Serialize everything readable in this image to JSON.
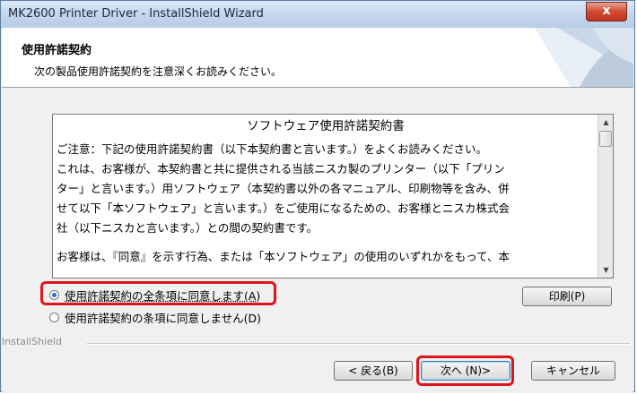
{
  "window": {
    "title": "MK2600 Printer Driver - InstallShield Wizard",
    "close_label": "x"
  },
  "header": {
    "title": "使用許諾契約",
    "subtitle": "次の製品使用許諾契約を注意深くお読みください。"
  },
  "license": {
    "title": "ソフトウェア使用許諾契約書",
    "paragraph1": "ご注意：下記の使用許諾契約書（以下本契約書と言います。）をよくお読みください。",
    "paragraph2_lines": [
      "これは、お客様が、本契約書と共に提供される当該ニスカ製のプリンター（以下「プリン",
      "ター」と言います。）用ソフトウェア（本契約書以外の各マニュアル、印刷物等を含み、併",
      "せて以下「本ソフトウェア」と言います。）をご使用になるための、お客様とニスカ株式会",
      "社（以下ニスカと言います。）との間の契約書です。"
    ],
    "paragraph3": "お客様は、『同意』を示す行為、または「本ソフトウェア」の使用のいずれかをもって、本"
  },
  "options": {
    "accept": "使用許諾契約の全条項に同意します(A)",
    "decline": "使用許諾契約の条項に同意しません(D)",
    "selected": "accept"
  },
  "buttons": {
    "print": "印刷(P)",
    "back": "< 戻る(B)",
    "next": "次へ (N)>",
    "cancel": "キャンセル"
  },
  "footer": {
    "brand": "InstallShield"
  },
  "colors": {
    "highlight": "#e0141c",
    "radio_dot": "#1f6fd6"
  }
}
